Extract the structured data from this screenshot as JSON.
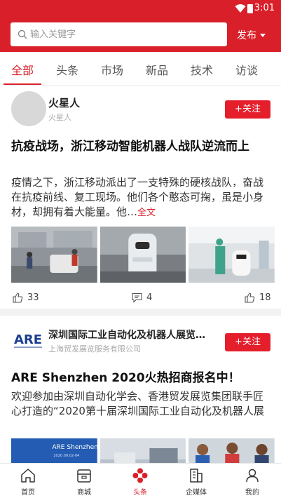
{
  "status_bar": {
    "time": "3:01",
    "wifi_icon": "wifi-icon",
    "battery_icon": "battery-icon"
  },
  "search": {
    "placeholder": "输入关键字",
    "publish_label": "发布"
  },
  "tabs": [
    {
      "label": "全部",
      "active": true
    },
    {
      "label": "头条"
    },
    {
      "label": "市场"
    },
    {
      "label": "新品"
    },
    {
      "label": "技术"
    },
    {
      "label": "访谈"
    }
  ],
  "feed": [
    {
      "author": "火星人",
      "author_subtitle": "火星人",
      "follow_label": "+关注",
      "title": "抗疫战场，浙江移动智能机器人战队逆流而上",
      "body": "疫情之下，浙江移动派出了一支特殊的硬核战队，奋战在抗疫前线、复工现场。他们各个憨态可掬，虽是小身材，却拥有着大能量。他…",
      "more_label": "全文",
      "likes": "33",
      "comments": "4",
      "thumbs_up": "18"
    },
    {
      "author": "深圳国际工业自动化及机器人展览…",
      "author_subtitle": "上海贸发展览服务有限公司",
      "logo_text": "ARE",
      "follow_label": "+关注",
      "title": "ARE Shenzhen 2020火热招商报名中！",
      "body": "欢迎参加由深圳自动化学会、香港贸发展览集团联手匠心打造的“2020第十届深圳国际工业自动化及机器人展",
      "thumb_text": "ARE Shenzhen",
      "thumb_date": "2020.09.02-04"
    }
  ],
  "bottom_nav": [
    {
      "label": "首页",
      "icon": "home-icon"
    },
    {
      "label": "商城",
      "icon": "store-icon"
    },
    {
      "label": "头条",
      "icon": "headline-icon",
      "active": true
    },
    {
      "label": "企媒体",
      "icon": "building-icon"
    },
    {
      "label": "我的",
      "icon": "user-icon"
    }
  ],
  "colors": {
    "brand": "#d9202a",
    "follow_button": "#e41e2b",
    "text": "#222222",
    "muted": "#aaaaaa"
  }
}
